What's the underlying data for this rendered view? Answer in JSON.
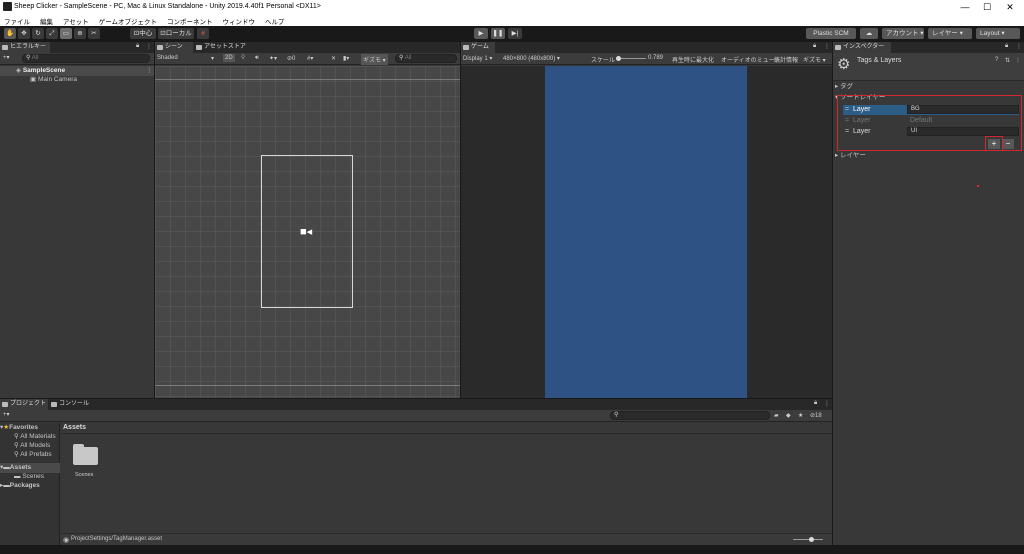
{
  "window": {
    "title": "Sheep Clicker - SampleScene - PC, Mac & Linux Standalone - Unity 2019.4.40f1 Personal <DX11>",
    "minimize": "—",
    "maximize": "☐",
    "close": "✕"
  },
  "menu": [
    "ファイル",
    "編集",
    "アセット",
    "ゲームオブジェクト",
    "コンポーネント",
    "ウィンドウ",
    "ヘルプ"
  ],
  "toolbar": {
    "pivot": "中心",
    "space": "ローカル",
    "plastic": "Plastic SCM",
    "account": "アカウント",
    "layers": "レイヤー",
    "layout": "Layout"
  },
  "hierarchy": {
    "tab": "ヒエラルキー",
    "search_placeholder": "All",
    "scene": "SampleScene",
    "objects": [
      "Main Camera"
    ]
  },
  "scene_view": {
    "tab_scene": "シーン",
    "tab_store": "アセットストア",
    "shading": "Shaded",
    "mode2d": "2D",
    "gizmo_count": "0",
    "gizmos": "ギズモ",
    "search_placeholder": "All"
  },
  "game_view": {
    "tab": "ゲーム",
    "display": "Display 1",
    "resolution": "480×800 (480x800)",
    "scale_label": "スケール",
    "scale_value": "0.789",
    "maximize_on_play": "再生時に最大化",
    "mute_audio": "オーディオのミュート",
    "stats": "統計情報",
    "gizmos": "ギズモ",
    "canvas_color": "#2f5285"
  },
  "inspector": {
    "tab": "インスペクター",
    "title": "Tags & Layers",
    "tags_section": "タグ",
    "sorting_section": "ソートレイヤー",
    "layers_section": "レイヤー",
    "sorting_layers": [
      {
        "label": "Layer",
        "value": "BG"
      },
      {
        "label": "Layer",
        "value": "Default"
      },
      {
        "label": "Layer",
        "value": "UI"
      }
    ],
    "add_button": "+",
    "remove_button": "−",
    "highlight_color": "#d0282e"
  },
  "project": {
    "tab_project": "プロジェクト",
    "tab_console": "コンソール",
    "favorites": "Favorites",
    "favorite_items": [
      "All Materials",
      "All Models",
      "All Prefabs"
    ],
    "assets": "Assets",
    "asset_children": [
      "Scenes"
    ],
    "packages": "Packages",
    "breadcrumb": "Assets",
    "folders": [
      "Scenes"
    ],
    "footer_path": "ProjectSettings/TagManager.asset",
    "hidden_count": "18"
  }
}
